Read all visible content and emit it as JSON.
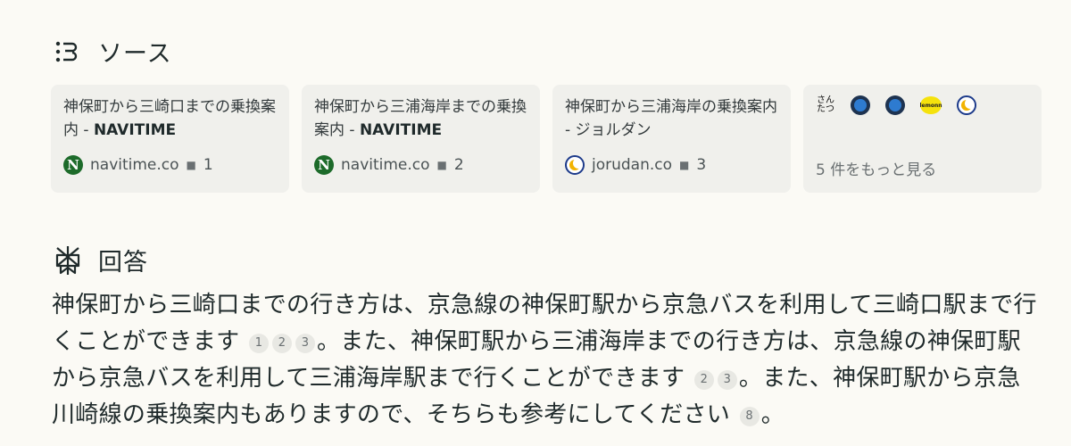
{
  "sources_section": {
    "title": "ソース",
    "icon": "sources-icon"
  },
  "source_cards": [
    {
      "title_prefix": "神保町から三崎口までの乗換案内 - ",
      "title_brand": "NAVITIME",
      "domain": "navitime.co",
      "index": "1",
      "favicon": "navitime-favicon",
      "favicon_letter": "N"
    },
    {
      "title_prefix": "神保町から三浦海岸までの乗換案内 - ",
      "title_brand": "NAVITIME",
      "domain": "navitime.co",
      "index": "2",
      "favicon": "navitime-favicon",
      "favicon_letter": "N"
    },
    {
      "title_prefix": "神保町から三浦海岸の乗換案内 - ジョルダン",
      "title_brand": "",
      "domain": "jorudan.co",
      "index": "3",
      "favicon": "jorudan-favicon"
    }
  ],
  "more_card": {
    "label": "5 件をもっと見る",
    "icon_text_1": "さんたつ",
    "lemon_text": "lemonn"
  },
  "answer_section": {
    "title": "回答",
    "icon": "perplexity-icon"
  },
  "answer": {
    "part1": "神保町から三崎口までの行き方は、京急線の神保町駅から京急バスを利用して三崎口駅まで行くことができます",
    "cites1": [
      "1",
      "2",
      "3"
    ],
    "part2": "。また、神保町駅から三浦海岸までの行き方は、京急線の神保町駅から京急バスを利用して三浦海岸駅まで行くことができます",
    "cites2": [
      "2",
      "3"
    ],
    "part3": "。また、神保町駅から京急川崎線の乗換案内もありますので、そちらも参考にしてください",
    "cites3": [
      "8"
    ],
    "part4": "。"
  },
  "colors": {
    "background": "#fbfaf5",
    "card": "#f0f0ec",
    "text": "#1f2a2b",
    "muted": "#6a7072",
    "navitime_green": "#1d6b2a"
  }
}
